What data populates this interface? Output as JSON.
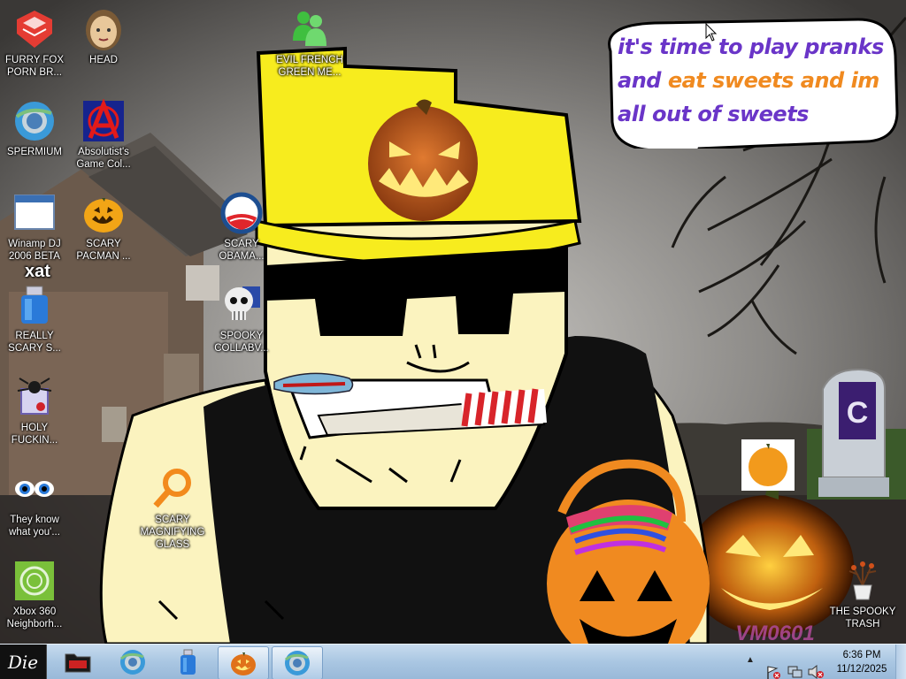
{
  "desktop": {
    "speech_bubble": {
      "line1": "it's time to play pranks",
      "line2_a": "and ",
      "line2_b": "eat sweets and im",
      "line3": "all out of sweets",
      "color_purple": "#6a35c8",
      "color_orange": "#f08a20"
    },
    "watermark": "VM0601",
    "hat_color": "#f7ec1e",
    "skin_color": "#fbf3bf",
    "shirt_color": "#111111",
    "icons": [
      {
        "name": "furry-fox",
        "label": "FURRY FOX PORN BR...",
        "icon": "red-diamond-logo-icon"
      },
      {
        "name": "head",
        "label": "HEAD",
        "icon": "face-icon"
      },
      {
        "name": "evil-french",
        "label": "EVIL FRENCH GREEN ME...",
        "icon": "green-people-icon"
      },
      {
        "name": "spermium",
        "label": "SPERMIUM",
        "icon": "chrome-like-globe-icon"
      },
      {
        "name": "absolutist",
        "label": "Absolutist's Game Col...",
        "icon": "anarchy-a-icon"
      },
      {
        "name": "winamp",
        "label": "Winamp DJ 2006 BETA",
        "icon": "window-icon"
      },
      {
        "name": "scary-pacman",
        "label": "SCARY PACMAN ...",
        "icon": "pumpkin-pacman-icon"
      },
      {
        "name": "scary-obama",
        "label": "SCARY OBAMA...",
        "icon": "obama-logo-icon"
      },
      {
        "name": "xat",
        "label": "REALLY SCARY S...",
        "icon": "xat-usb-icon",
        "badge": "xat"
      },
      {
        "name": "spooky-collab",
        "label": "SPOOKY COLLABV...",
        "icon": "skull-icon"
      },
      {
        "name": "holy",
        "label": "HOLY FUCKIN...",
        "icon": "spider-package-icon"
      },
      {
        "name": "they-know",
        "label": "They know what you'...",
        "icon": "eyes-icon"
      },
      {
        "name": "scary-magnifying",
        "label": "SCARY MAGNIFYING GLASS",
        "icon": "magnifying-glass-icon"
      },
      {
        "name": "xbox",
        "label": "Xbox 360 Neighborh...",
        "icon": "xbox-icon"
      },
      {
        "name": "trash",
        "label": "THE SPOOKY TRASH",
        "icon": "trash-plant-icon"
      }
    ]
  },
  "taskbar": {
    "start_label": "Die",
    "buttons": [
      {
        "name": "folder",
        "icon": "dark-folder-icon"
      },
      {
        "name": "browser",
        "icon": "chrome-like-globe-icon"
      },
      {
        "name": "usb",
        "icon": "usb-drive-icon"
      },
      {
        "name": "pumpkin",
        "icon": "pumpkin-icon",
        "active": true
      },
      {
        "name": "browser2",
        "icon": "chrome-like-globe-icon",
        "active": true
      }
    ],
    "tray": {
      "chevron": "▲",
      "time": "6:36 PM",
      "date": "11/12/2025"
    }
  }
}
